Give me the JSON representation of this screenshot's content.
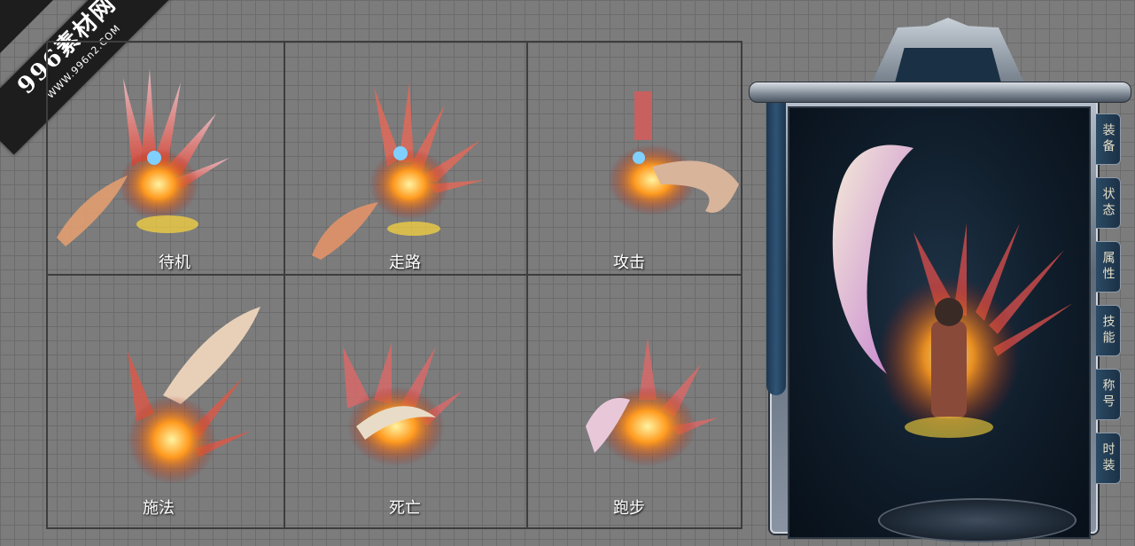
{
  "watermark": {
    "main": "996素材网",
    "url": "WWW.996n2.COM"
  },
  "grid": {
    "cells": [
      {
        "label": "待机"
      },
      {
        "label": "走路"
      },
      {
        "label": "攻击"
      },
      {
        "label": "施法"
      },
      {
        "label": "死亡"
      },
      {
        "label": "跑步"
      }
    ]
  },
  "panel": {
    "tabs": [
      "装备",
      "状态",
      "属性",
      "技能",
      "称号",
      "时装"
    ]
  },
  "colors": {
    "background": "#7c7c7c",
    "grid_line": "#3d3d3d",
    "panel_inner": "#0f1c29",
    "label": "#ffffff"
  }
}
